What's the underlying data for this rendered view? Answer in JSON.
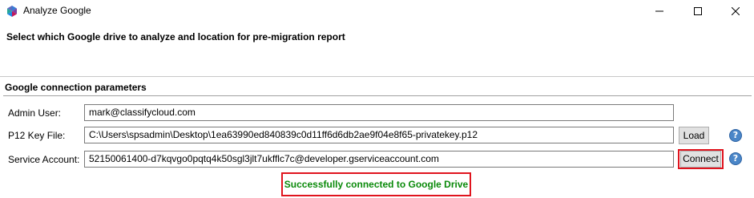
{
  "window": {
    "title": "Analyze Google",
    "controls": {
      "minimize": "minimize-icon",
      "maximize": "maximize-icon",
      "close": "close-icon"
    }
  },
  "header": {
    "title": "Select which Google drive to analyze and location for pre-migration report"
  },
  "group": {
    "title": "Google connection parameters"
  },
  "form": {
    "admin_user": {
      "label": "Admin User:",
      "value": "mark@classifycloud.com"
    },
    "p12_key_file": {
      "label": "P12 Key File:",
      "value": "C:\\Users\\spsadmin\\Desktop\\1ea63990ed840839c0d11ff6d6db2ae9f04e8f65-privatekey.p12",
      "button_label": "Load"
    },
    "service_account": {
      "label": "Service Account:",
      "value": "52150061400-d7kqvgo0pqtq4k50sgl3jlt7ukfflc7c@developer.gserviceaccount.com",
      "button_label": "Connect"
    }
  },
  "status": {
    "message": "Successfully connected to Google Drive",
    "color": "#0a8a0a"
  },
  "colors": {
    "highlight": "#e0141e",
    "help_icon": "#4a86c8"
  }
}
